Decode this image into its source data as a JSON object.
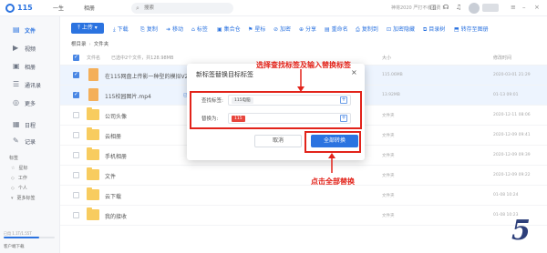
{
  "topbar": {
    "logo_text": "115",
    "nav": [
      "一生",
      "相册"
    ],
    "search_placeholder": "搜索",
    "promo": "神将2020 严打不收收费 ！"
  },
  "sidebar": {
    "items": [
      {
        "icon": "file-icon",
        "glyph": "▤",
        "label": "文件"
      },
      {
        "icon": "video-icon",
        "glyph": "▶",
        "label": "视频"
      },
      {
        "icon": "photo-icon",
        "glyph": "▣",
        "label": "相册"
      },
      {
        "icon": "contacts-icon",
        "glyph": "☰",
        "label": "通讯录"
      },
      {
        "icon": "more-icon",
        "glyph": "◎",
        "label": "更多"
      },
      {
        "icon": "calendar-icon",
        "glyph": "▦",
        "label": "日程"
      },
      {
        "icon": "note-icon",
        "glyph": "✎",
        "label": "记录"
      }
    ],
    "sub_items": [
      {
        "glyph": "☆",
        "label": "星标"
      },
      {
        "glyph": "◇",
        "label": "工作"
      },
      {
        "glyph": "◇",
        "label": "个人"
      },
      {
        "glyph": "▾",
        "label": "更多标签"
      }
    ],
    "sub_header": "标签",
    "storage_text": "已用 1.1T/1.55T",
    "storage_used": 0.7,
    "client_link": "客户端下载"
  },
  "toolbar": {
    "upload": "上传",
    "actions": [
      {
        "glyph": "⤓",
        "label": "下载"
      },
      {
        "glyph": "⎘",
        "label": "复制"
      },
      {
        "glyph": "➜",
        "label": "移动"
      },
      {
        "glyph": "⌂",
        "label": "标签"
      },
      {
        "glyph": "▣",
        "label": "集合仓"
      },
      {
        "glyph": "⚑",
        "label": "星标"
      },
      {
        "glyph": "⊘",
        "label": "加密"
      },
      {
        "glyph": "⊕",
        "label": "分享"
      },
      {
        "glyph": "▤",
        "label": "重命名"
      },
      {
        "glyph": "⎙",
        "label": "复制到"
      },
      {
        "glyph": "⊡",
        "label": "加密隐藏"
      },
      {
        "glyph": "⧉",
        "label": "目录树"
      },
      {
        "glyph": "⬒",
        "label": "转存至图册"
      }
    ]
  },
  "breadcrumb": [
    "根目录",
    "文件夹"
  ],
  "table": {
    "headers": [
      "文件名",
      "已选中2个文件，共128.98MB",
      "大小",
      "修改时间"
    ],
    "rows": [
      {
        "type": "video",
        "name": "在115网盘上传影一种型的模拟V2024…",
        "sub": "",
        "size": "115.06MB",
        "date": "2020-03-01 21:29",
        "selected": true
      },
      {
        "type": "video",
        "name": "115校园图片.mp4",
        "sub": "已经转码 1%",
        "size": "13.92MB",
        "date": "01-13 09:01",
        "selected": true
      },
      {
        "type": "folder",
        "name": "公司头像",
        "sub": "",
        "size": "文件夹",
        "date": "2020-12-11 08:06",
        "selected": false
      },
      {
        "type": "folder",
        "name": "云相册",
        "sub": "",
        "size": "文件夹",
        "date": "2020-12-09 09:41",
        "selected": false
      },
      {
        "type": "folder",
        "name": "手机相册",
        "sub": "",
        "size": "文件夹",
        "date": "2020-12-09 09:39",
        "selected": false
      },
      {
        "type": "folder",
        "name": "文件",
        "sub": "",
        "size": "文件夹",
        "date": "2020-12-09 09:22",
        "selected": false
      },
      {
        "type": "folder",
        "name": "云下载",
        "sub": "",
        "size": "文件夹",
        "date": "01-08 10:24",
        "selected": false
      },
      {
        "type": "folder",
        "name": "我的接收",
        "sub": "",
        "size": "文件夹",
        "date": "01-08 10:23",
        "selected": false
      }
    ]
  },
  "modal": {
    "title": "新标签替换目标标签",
    "find_label": "查找标签:",
    "find_tag": "115电脑",
    "replace_label": "替换为:",
    "replace_tag": "115",
    "cancel": "取消",
    "replace_all": "全部转换"
  },
  "annotations": {
    "note1": "选择查找标签及输入替换标签",
    "note2": "点击全部替换",
    "color": "#e2231a"
  },
  "watermark": "5",
  "colors": {
    "accent": "#2b73e0",
    "folder": "#f7c443",
    "annotation": "#e2231a"
  }
}
